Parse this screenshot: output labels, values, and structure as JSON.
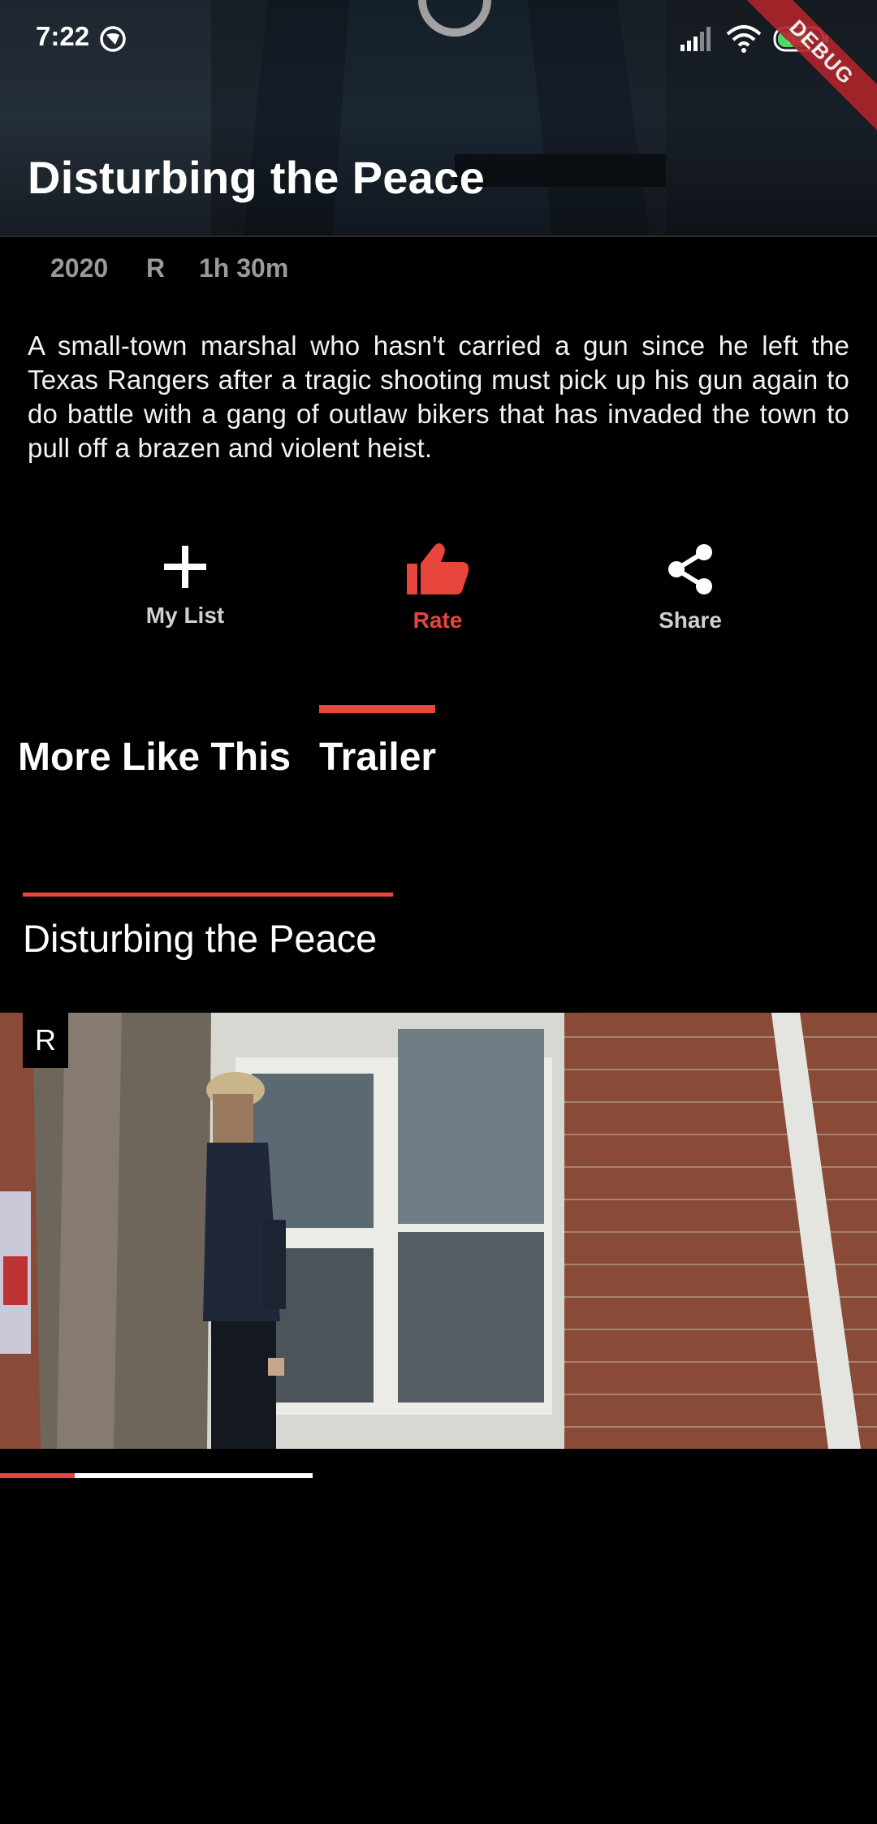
{
  "status_bar": {
    "time": "7:22",
    "battery": "63",
    "debug_banner": "DEBUG"
  },
  "movie": {
    "title": "Disturbing the Peace",
    "year": "2020",
    "rating": "R",
    "runtime": "1h 30m",
    "description": "A small-town marshal who hasn't carried a gun since he left the Texas Rangers after a tragic shooting must pick up his gun again to do battle with a gang of outlaw bikers that has invaded the town to pull off a brazen and violent heist."
  },
  "actions": [
    {
      "label": "My List",
      "icon": "plus-icon",
      "active": false
    },
    {
      "label": "Rate",
      "icon": "thumbs-up-icon",
      "active": true
    },
    {
      "label": "Share",
      "icon": "share-icon",
      "active": false
    }
  ],
  "tabs": [
    {
      "label": "More Like This",
      "selected": false
    },
    {
      "label": "Trailer",
      "selected": true
    }
  ],
  "trailer": {
    "title": "Disturbing the Peace",
    "rating_badge": "R",
    "progress_fraction": 0.24
  },
  "colors": {
    "accent": "#e8453c",
    "background": "#000000",
    "muted_text": "#9a9a9a"
  }
}
